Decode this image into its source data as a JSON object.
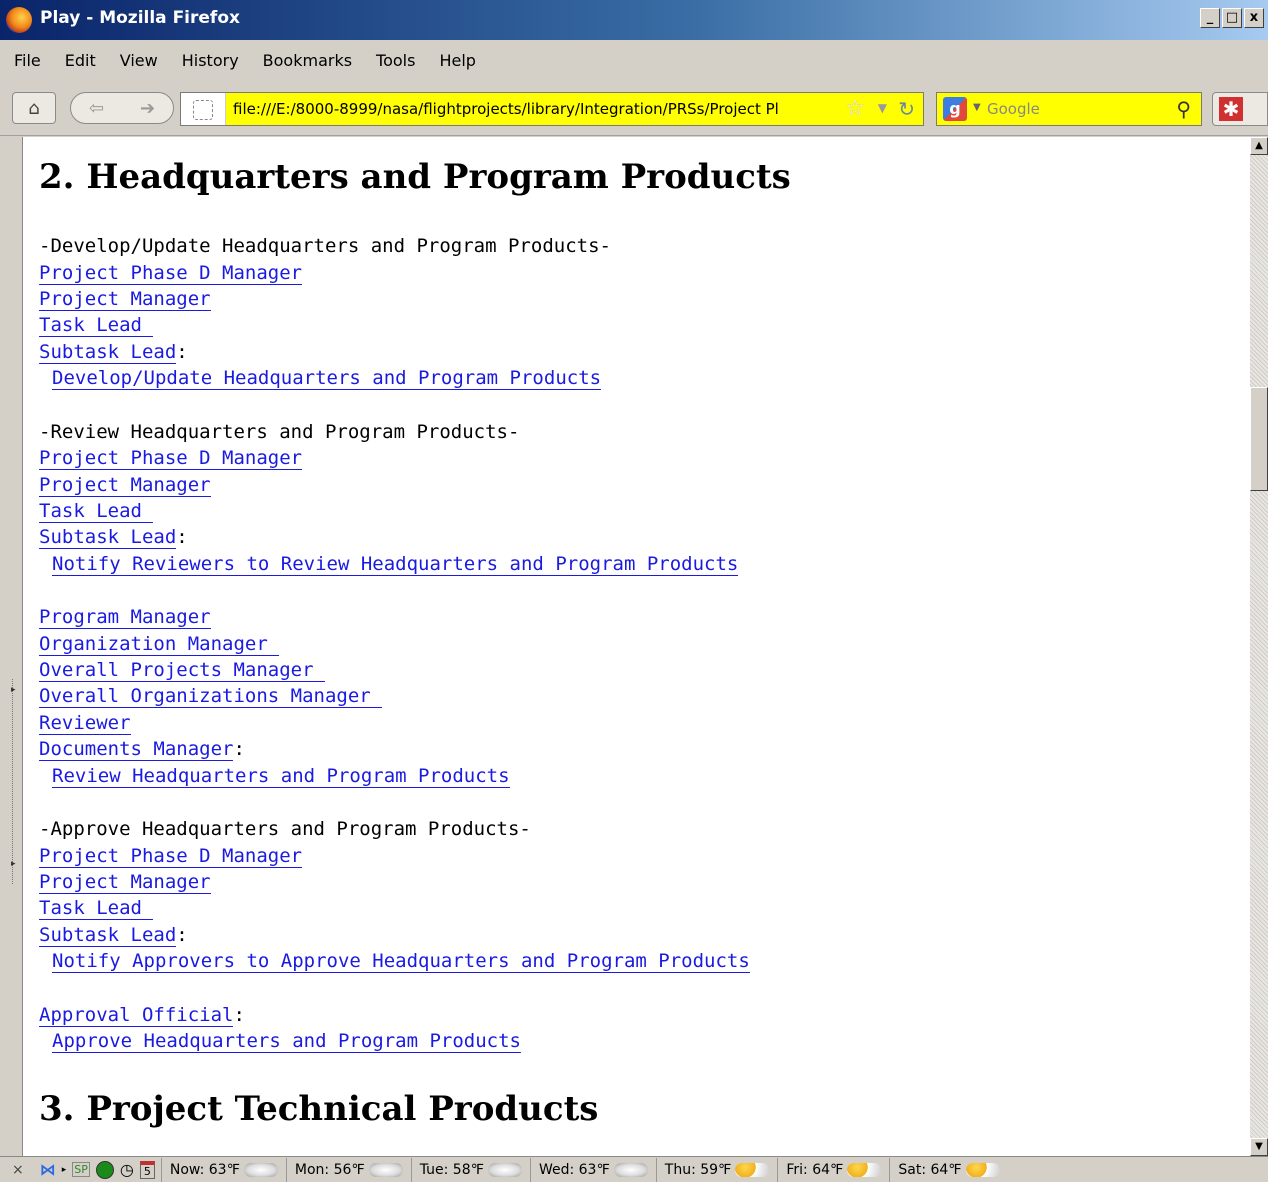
{
  "window": {
    "title": "Play - Mozilla Firefox",
    "buttons": [
      "_",
      "□",
      "x"
    ]
  },
  "menubar": [
    {
      "label": "File"
    },
    {
      "label": "Edit"
    },
    {
      "label": "View"
    },
    {
      "label": "History"
    },
    {
      "label": "Bookmarks"
    },
    {
      "label": "Tools"
    },
    {
      "label": "Help"
    }
  ],
  "navbar": {
    "url": "file:///E:/8000-8999/nasa/flightprojects/library/Integration/PRSs/Project Pl",
    "search_engine": "Google",
    "highlight_color": "#ffff00"
  },
  "page": {
    "section2_title": "2. Headquarters and Program Products",
    "develop_heading": "-Develop/Update Headquarters and Program Products-",
    "review_heading": "-Review Headquarters and Program Products-",
    "approve_heading": "-Approve Headquarters and Program Products-",
    "roles": {
      "project_phase_d_manager": "Project Phase D Manager",
      "project_manager": "Project Manager",
      "task_lead": "Task Lead ",
      "subtask_lead": "Subtask Lead",
      "program_manager": "Program Manager",
      "organization_manager": "Organization Manager ",
      "overall_projects_manager": "Overall Projects Manager ",
      "overall_organizations_manager": "Overall Organizations Manager ",
      "reviewer": "Reviewer",
      "documents_manager": "Documents Manager",
      "approval_official": "Approval Official"
    },
    "colon": ":",
    "tasks": {
      "develop": "Develop/Update Headquarters and Program Products",
      "notify_reviewers": "Notify Reviewers to Review Headquarters and Program Products",
      "review": "Review Headquarters and Program Products",
      "notify_approvers": "Notify Approvers to Approve Headquarters and Program Products",
      "approve": "Approve Headquarters and Program Products"
    },
    "section3_title": "3. Project Technical Products"
  },
  "statusbar": {
    "close": "×",
    "sp_label": "SP",
    "calendar_day": "5",
    "weather": [
      {
        "label": "Now: 63℉"
      },
      {
        "label": "Mon: 56℉"
      },
      {
        "label": "Tue: 58℉"
      },
      {
        "label": "Wed: 63℉"
      },
      {
        "label": "Thu: 59℉"
      },
      {
        "label": "Fri: 64℉"
      },
      {
        "label": "Sat: 64℉"
      }
    ]
  }
}
